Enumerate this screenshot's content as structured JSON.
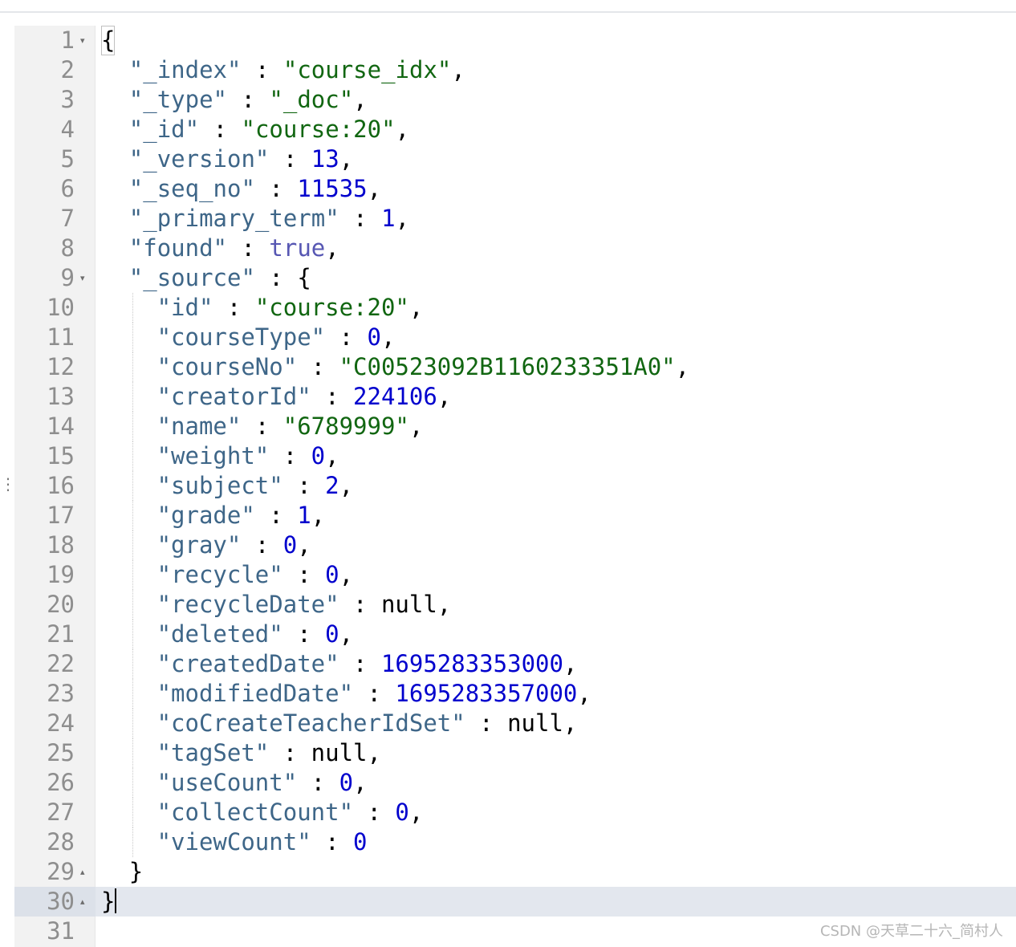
{
  "editor": {
    "lines": [
      {
        "num": "1",
        "fold": "▾",
        "indent": 0,
        "tokens": [
          {
            "t": "{",
            "c": "brace-open"
          }
        ]
      },
      {
        "num": "2",
        "fold": "",
        "indent": 1,
        "tokens": [
          {
            "t": "\"_index\"",
            "c": "k"
          },
          {
            "t": " : ",
            "c": "p"
          },
          {
            "t": "\"course_idx\"",
            "c": "s"
          },
          {
            "t": ",",
            "c": "p"
          }
        ]
      },
      {
        "num": "3",
        "fold": "",
        "indent": 1,
        "tokens": [
          {
            "t": "\"_type\"",
            "c": "k"
          },
          {
            "t": " : ",
            "c": "p"
          },
          {
            "t": "\"_doc\"",
            "c": "s"
          },
          {
            "t": ",",
            "c": "p"
          }
        ]
      },
      {
        "num": "4",
        "fold": "",
        "indent": 1,
        "tokens": [
          {
            "t": "\"_id\"",
            "c": "k"
          },
          {
            "t": " : ",
            "c": "p"
          },
          {
            "t": "\"course:20\"",
            "c": "s"
          },
          {
            "t": ",",
            "c": "p"
          }
        ]
      },
      {
        "num": "5",
        "fold": "",
        "indent": 1,
        "tokens": [
          {
            "t": "\"_version\"",
            "c": "k"
          },
          {
            "t": " : ",
            "c": "p"
          },
          {
            "t": "13",
            "c": "n"
          },
          {
            "t": ",",
            "c": "p"
          }
        ]
      },
      {
        "num": "6",
        "fold": "",
        "indent": 1,
        "tokens": [
          {
            "t": "\"_seq_no\"",
            "c": "k"
          },
          {
            "t": " : ",
            "c": "p"
          },
          {
            "t": "11535",
            "c": "n"
          },
          {
            "t": ",",
            "c": "p"
          }
        ]
      },
      {
        "num": "7",
        "fold": "",
        "indent": 1,
        "tokens": [
          {
            "t": "\"_primary_term\"",
            "c": "k"
          },
          {
            "t": " : ",
            "c": "p"
          },
          {
            "t": "1",
            "c": "n"
          },
          {
            "t": ",",
            "c": "p"
          }
        ]
      },
      {
        "num": "8",
        "fold": "",
        "indent": 1,
        "tokens": [
          {
            "t": "\"found\"",
            "c": "k"
          },
          {
            "t": " : ",
            "c": "p"
          },
          {
            "t": "true",
            "c": "b"
          },
          {
            "t": ",",
            "c": "p"
          }
        ]
      },
      {
        "num": "9",
        "fold": "▾",
        "indent": 1,
        "tokens": [
          {
            "t": "\"_source\"",
            "c": "k"
          },
          {
            "t": " : {",
            "c": "p"
          }
        ]
      },
      {
        "num": "10",
        "fold": "",
        "indent": 2,
        "tokens": [
          {
            "t": "\"id\"",
            "c": "k"
          },
          {
            "t": " : ",
            "c": "p"
          },
          {
            "t": "\"course:20\"",
            "c": "s"
          },
          {
            "t": ",",
            "c": "p"
          }
        ]
      },
      {
        "num": "11",
        "fold": "",
        "indent": 2,
        "tokens": [
          {
            "t": "\"courseType\"",
            "c": "k"
          },
          {
            "t": " : ",
            "c": "p"
          },
          {
            "t": "0",
            "c": "n"
          },
          {
            "t": ",",
            "c": "p"
          }
        ]
      },
      {
        "num": "12",
        "fold": "",
        "indent": 2,
        "tokens": [
          {
            "t": "\"courseNo\"",
            "c": "k"
          },
          {
            "t": " : ",
            "c": "p"
          },
          {
            "t": "\"C00523092B1160233351A0\"",
            "c": "s"
          },
          {
            "t": ",",
            "c": "p"
          }
        ]
      },
      {
        "num": "13",
        "fold": "",
        "indent": 2,
        "tokens": [
          {
            "t": "\"creatorId\"",
            "c": "k"
          },
          {
            "t": " : ",
            "c": "p"
          },
          {
            "t": "224106",
            "c": "n"
          },
          {
            "t": ",",
            "c": "p"
          }
        ]
      },
      {
        "num": "14",
        "fold": "",
        "indent": 2,
        "tokens": [
          {
            "t": "\"name\"",
            "c": "k"
          },
          {
            "t": " : ",
            "c": "p"
          },
          {
            "t": "\"6789999\"",
            "c": "s"
          },
          {
            "t": ",",
            "c": "p"
          }
        ]
      },
      {
        "num": "15",
        "fold": "",
        "indent": 2,
        "tokens": [
          {
            "t": "\"weight\"",
            "c": "k"
          },
          {
            "t": " : ",
            "c": "p"
          },
          {
            "t": "0",
            "c": "n"
          },
          {
            "t": ",",
            "c": "p"
          }
        ]
      },
      {
        "num": "16",
        "fold": "",
        "indent": 2,
        "tokens": [
          {
            "t": "\"subject\"",
            "c": "k"
          },
          {
            "t": " : ",
            "c": "p"
          },
          {
            "t": "2",
            "c": "n"
          },
          {
            "t": ",",
            "c": "p"
          }
        ]
      },
      {
        "num": "17",
        "fold": "",
        "indent": 2,
        "tokens": [
          {
            "t": "\"grade\"",
            "c": "k"
          },
          {
            "t": " : ",
            "c": "p"
          },
          {
            "t": "1",
            "c": "n"
          },
          {
            "t": ",",
            "c": "p"
          }
        ]
      },
      {
        "num": "18",
        "fold": "",
        "indent": 2,
        "tokens": [
          {
            "t": "\"gray\"",
            "c": "k"
          },
          {
            "t": " : ",
            "c": "p"
          },
          {
            "t": "0",
            "c": "n"
          },
          {
            "t": ",",
            "c": "p"
          }
        ]
      },
      {
        "num": "19",
        "fold": "",
        "indent": 2,
        "tokens": [
          {
            "t": "\"recycle\"",
            "c": "k"
          },
          {
            "t": " : ",
            "c": "p"
          },
          {
            "t": "0",
            "c": "n"
          },
          {
            "t": ",",
            "c": "p"
          }
        ]
      },
      {
        "num": "20",
        "fold": "",
        "indent": 2,
        "tokens": [
          {
            "t": "\"recycleDate\"",
            "c": "k"
          },
          {
            "t": " : null,",
            "c": "p"
          }
        ]
      },
      {
        "num": "21",
        "fold": "",
        "indent": 2,
        "tokens": [
          {
            "t": "\"deleted\"",
            "c": "k"
          },
          {
            "t": " : ",
            "c": "p"
          },
          {
            "t": "0",
            "c": "n"
          },
          {
            "t": ",",
            "c": "p"
          }
        ]
      },
      {
        "num": "22",
        "fold": "",
        "indent": 2,
        "tokens": [
          {
            "t": "\"createdDate\"",
            "c": "k"
          },
          {
            "t": " : ",
            "c": "p"
          },
          {
            "t": "1695283353000",
            "c": "n"
          },
          {
            "t": ",",
            "c": "p"
          }
        ]
      },
      {
        "num": "23",
        "fold": "",
        "indent": 2,
        "tokens": [
          {
            "t": "\"modifiedDate\"",
            "c": "k"
          },
          {
            "t": " : ",
            "c": "p"
          },
          {
            "t": "1695283357000",
            "c": "n"
          },
          {
            "t": ",",
            "c": "p"
          }
        ]
      },
      {
        "num": "24",
        "fold": "",
        "indent": 2,
        "tokens": [
          {
            "t": "\"coCreateTeacherIdSet\"",
            "c": "k"
          },
          {
            "t": " : null,",
            "c": "p"
          }
        ]
      },
      {
        "num": "25",
        "fold": "",
        "indent": 2,
        "tokens": [
          {
            "t": "\"tagSet\"",
            "c": "k"
          },
          {
            "t": " : null,",
            "c": "p"
          }
        ]
      },
      {
        "num": "26",
        "fold": "",
        "indent": 2,
        "tokens": [
          {
            "t": "\"useCount\"",
            "c": "k"
          },
          {
            "t": " : ",
            "c": "p"
          },
          {
            "t": "0",
            "c": "n"
          },
          {
            "t": ",",
            "c": "p"
          }
        ]
      },
      {
        "num": "27",
        "fold": "",
        "indent": 2,
        "tokens": [
          {
            "t": "\"collectCount\"",
            "c": "k"
          },
          {
            "t": " : ",
            "c": "p"
          },
          {
            "t": "0",
            "c": "n"
          },
          {
            "t": ",",
            "c": "p"
          }
        ]
      },
      {
        "num": "28",
        "fold": "",
        "indent": 2,
        "tokens": [
          {
            "t": "\"viewCount\"",
            "c": "k"
          },
          {
            "t": " : ",
            "c": "p"
          },
          {
            "t": "0",
            "c": "n"
          }
        ]
      },
      {
        "num": "29",
        "fold": "▴",
        "indent": 1,
        "tokens": [
          {
            "t": "}",
            "c": "p"
          }
        ]
      },
      {
        "num": "30",
        "fold": "▴",
        "indent": 0,
        "active": true,
        "tokens": [
          {
            "t": "}",
            "c": "p"
          }
        ],
        "cursor": true
      },
      {
        "num": "31",
        "fold": "",
        "indent": 0,
        "tokens": []
      }
    ]
  },
  "watermark": "CSDN @天草二十六_简村人",
  "colors": {
    "key": "#3e6688",
    "string": "#116611",
    "number": "#0000cd",
    "boolean": "#5757b3",
    "gutter_bg": "#f2f2f2",
    "active_line": "#e3e7ee"
  }
}
